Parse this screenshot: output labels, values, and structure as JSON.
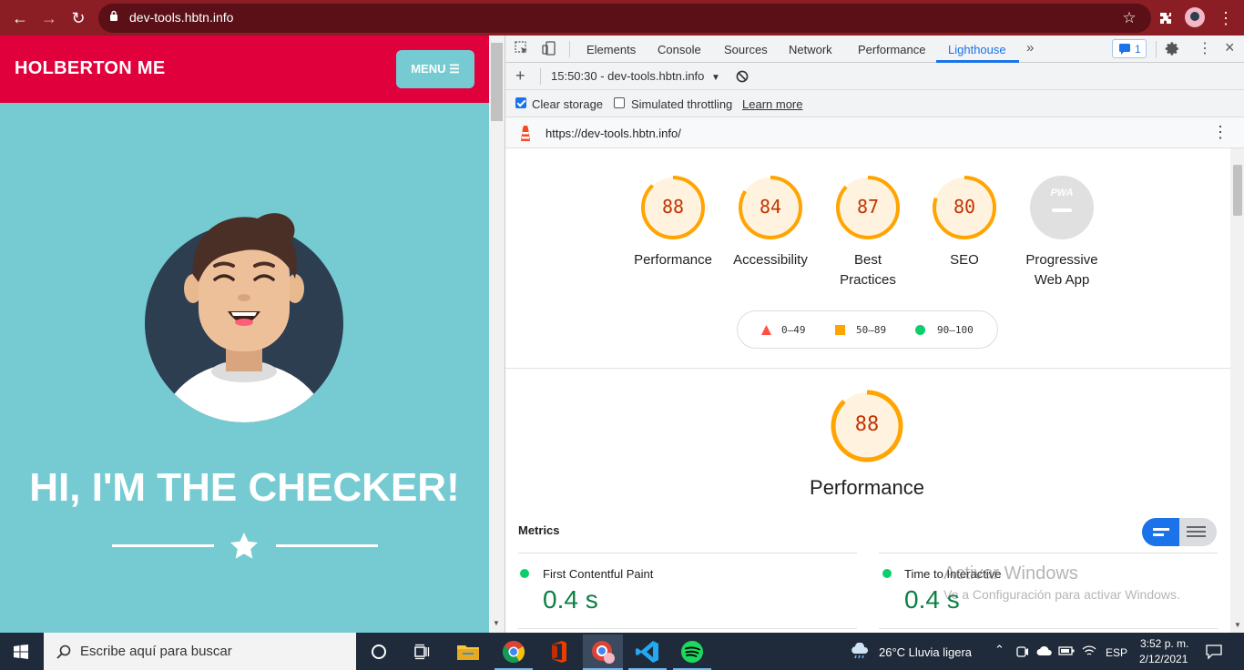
{
  "browser": {
    "url": "dev-tools.hbtn.info"
  },
  "page": {
    "brand": "HOLBERTON ME",
    "menu_label": "MENU",
    "hero_title": "HI, I'M THE CHECKER!"
  },
  "devtools": {
    "tabs": [
      "Elements",
      "Console",
      "Sources",
      "Network",
      "Performance",
      "Lighthouse"
    ],
    "active_tab": "Lighthouse",
    "issues_count": "1",
    "report_select": "15:50:30 - dev-tools.hbtn.info",
    "clear_storage_label": "Clear storage",
    "clear_storage_checked": true,
    "throttling_label": "Simulated throttling",
    "throttling_checked": false,
    "learn_more": "Learn more",
    "report_url": "https://dev-tools.hbtn.info/"
  },
  "scores": [
    {
      "label": "Performance",
      "value": "88",
      "score": 0.88
    },
    {
      "label": "Accessibility",
      "value": "84",
      "score": 0.84
    },
    {
      "label": "Best\nPractices",
      "value": "87",
      "score": 0.87
    },
    {
      "label": "SEO",
      "value": "80",
      "score": 0.8
    },
    {
      "label": "Progressive\nWeb App",
      "value": "PWA"
    }
  ],
  "legend": {
    "fail": "0–49",
    "average": "50–89",
    "pass": "90–100"
  },
  "performance": {
    "value": "88",
    "score": 0.88,
    "title": "Performance",
    "metrics_title": "Metrics",
    "metrics": [
      {
        "label": "First Contentful Paint",
        "value": "0.4 s"
      },
      {
        "label": "Time to Interactive",
        "value": "0.4 s"
      }
    ]
  },
  "watermark": {
    "line1": "Activar Windows",
    "line2": "Ve a Configuración para activar Windows."
  },
  "taskbar": {
    "search_placeholder": "Escribe aquí para buscar",
    "weather": "26°C  Lluvia ligera",
    "language": "ESP",
    "time": "3:52 p. m.",
    "date": "2/12/2021"
  },
  "colors": {
    "browser_bar": "#8b1e24",
    "page_header": "#e0003c",
    "page_bg": "#76cbd3",
    "gauge_average": "#ffa400",
    "gauge_average_bg": "#fff3e0",
    "pass_green": "#0cce6b"
  }
}
